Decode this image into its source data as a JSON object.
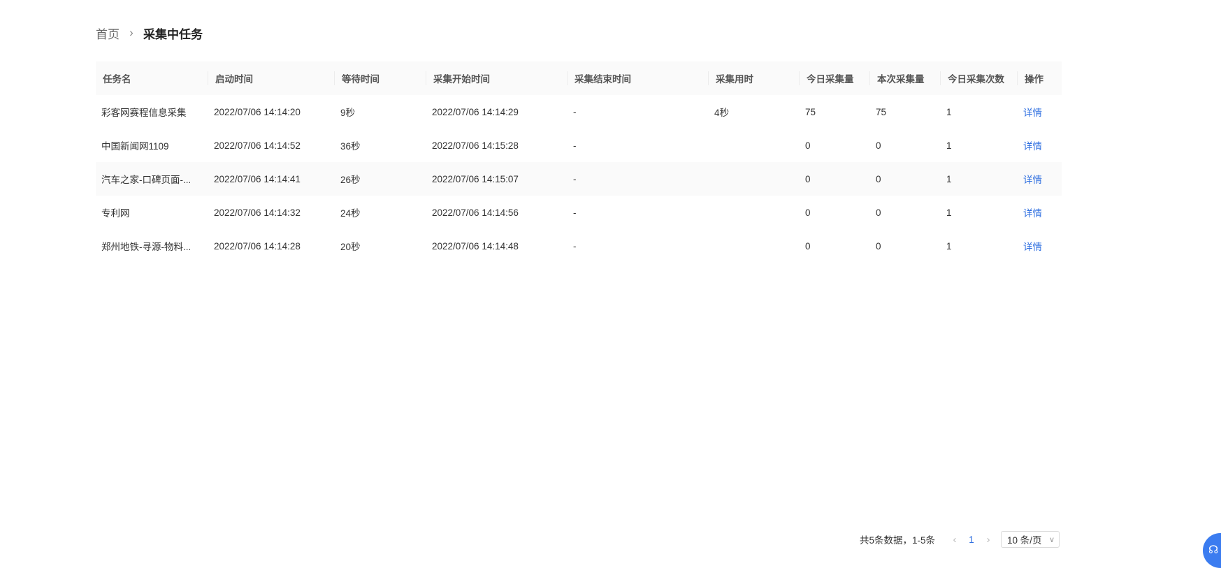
{
  "breadcrumb": {
    "home": "首页",
    "separator": "›",
    "current": "采集中任务"
  },
  "table": {
    "columns": [
      "任务名",
      "启动时间",
      "等待时间",
      "采集开始时间",
      "采集结束时间",
      "采集用时",
      "今日采集量",
      "本次采集量",
      "今日采集次数",
      "操作"
    ],
    "rows": [
      {
        "name": "彩客网赛程信息采集",
        "start": "2022/07/06 14:14:20",
        "wait": "9秒",
        "collect_start": "2022/07/06 14:14:29",
        "collect_end": "-",
        "duration": "4秒",
        "today_count": "75",
        "this_count": "75",
        "today_times": "1",
        "action": "详情"
      },
      {
        "name": "中国新闻网1109",
        "start": "2022/07/06 14:14:52",
        "wait": "36秒",
        "collect_start": "2022/07/06 14:15:28",
        "collect_end": "-",
        "duration": "",
        "today_count": "0",
        "this_count": "0",
        "today_times": "1",
        "action": "详情"
      },
      {
        "name": "汽车之家-口碑页面-...",
        "start": "2022/07/06 14:14:41",
        "wait": "26秒",
        "collect_start": "2022/07/06 14:15:07",
        "collect_end": "-",
        "duration": "",
        "today_count": "0",
        "this_count": "0",
        "today_times": "1",
        "action": "详情"
      },
      {
        "name": "专利网",
        "start": "2022/07/06 14:14:32",
        "wait": "24秒",
        "collect_start": "2022/07/06 14:14:56",
        "collect_end": "-",
        "duration": "",
        "today_count": "0",
        "this_count": "0",
        "today_times": "1",
        "action": "详情"
      },
      {
        "name": "郑州地铁-寻源-物料...",
        "start": "2022/07/06 14:14:28",
        "wait": "20秒",
        "collect_start": "2022/07/06 14:14:48",
        "collect_end": "-",
        "duration": "",
        "today_count": "0",
        "this_count": "0",
        "today_times": "1",
        "action": "详情"
      }
    ]
  },
  "pagination": {
    "total_text": "共5条数据，1-5条",
    "prev": "‹",
    "current_page": "1",
    "next": "›",
    "page_size": "10 条/页",
    "size_chevron": "∨"
  },
  "float_button": {
    "icon": "headset-icon",
    "glyph": "☊"
  },
  "colors": {
    "link": "#2f6fe0",
    "header_bg": "#fafafa",
    "float_button": "#3b7cf0"
  }
}
